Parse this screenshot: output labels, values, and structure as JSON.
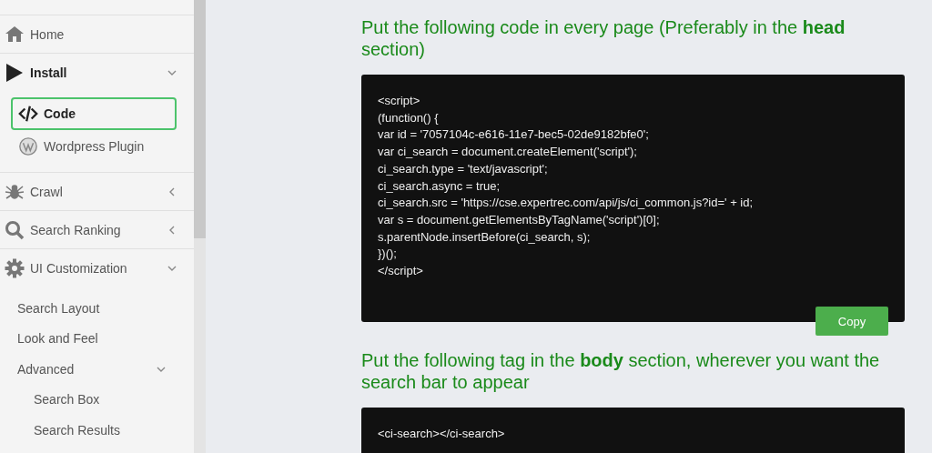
{
  "sidebar": {
    "items": [
      {
        "kind": "home",
        "label": "Home"
      },
      {
        "kind": "play",
        "label": "Install",
        "expanded": true,
        "children": [
          {
            "kind": "code",
            "label": "Code",
            "selected": true
          },
          {
            "kind": "wordpress",
            "label": "Wordpress Plugin",
            "selected": false
          }
        ]
      },
      {
        "kind": "spider",
        "label": "Crawl",
        "expanded": false
      },
      {
        "kind": "search",
        "label": "Search Ranking",
        "expanded": false
      },
      {
        "kind": "gear",
        "label": "UI Customization",
        "expanded": true,
        "children": [
          {
            "label": "Search Layout",
            "selected": false
          },
          {
            "label": "Look and Feel",
            "selected": false
          },
          {
            "label": "Advanced",
            "expanded": true,
            "selected": false,
            "children": [
              {
                "label": "Search Box",
                "selected": false
              },
              {
                "label": "Search Results",
                "selected": false
              }
            ]
          }
        ]
      }
    ]
  },
  "sections": [
    {
      "heading": "Put the following code in every page (Preferably in the **head** section)",
      "code": [
        "<script>",
        "(function() {",
        "var id = '7057104c-e616-11e7-bec5-02de9182bfe0';",
        "var ci_search = document.createElement('script');",
        "ci_search.type = 'text/javascript';",
        "ci_search.async = true;",
        "ci_search.src = 'https://cse.expertrec.com/api/js/ci_common.js?id=' + id;",
        "var s = document.getElementsByTagName('script')[0];",
        "s.parentNode.insertBefore(ci_search, s);",
        "})();",
        "</script>"
      ],
      "button": "Copy"
    },
    {
      "heading": "Put the following tag in the **body** section, wherever you want the search bar to appear",
      "code": [
        "<ci-search></ci-search>"
      ]
    }
  ]
}
